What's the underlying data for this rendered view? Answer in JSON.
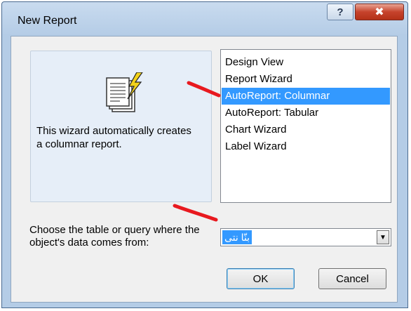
{
  "window": {
    "title": "New Report",
    "help_glyph": "?",
    "close_glyph": "✖"
  },
  "preview": {
    "icon": "report-wizard-icon",
    "description": "This wizard automatically creates a columnar report."
  },
  "wizard_list": {
    "items": [
      {
        "label": "Design View",
        "selected": false
      },
      {
        "label": "Report Wizard",
        "selected": false
      },
      {
        "label": "AutoReport:  Columnar",
        "selected": true
      },
      {
        "label": "AutoReport:  Tabular",
        "selected": false
      },
      {
        "label": "Chart Wizard",
        "selected": false
      },
      {
        "label": "Label Wizard",
        "selected": false
      }
    ]
  },
  "source": {
    "label": "Choose the table or query where the object's data comes from:",
    "value": "بنّا نتی",
    "dropdown_glyph": "▼"
  },
  "buttons": {
    "ok": "OK",
    "cancel": "Cancel"
  },
  "colors": {
    "selection": "#3399ff",
    "annotation_marks": "#e8191f"
  }
}
